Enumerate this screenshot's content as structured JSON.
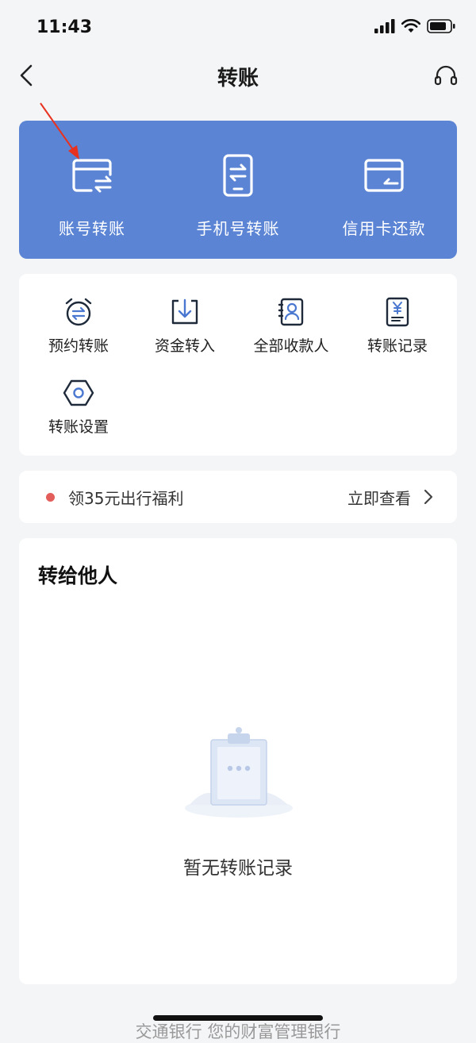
{
  "status_bar": {
    "time": "11:43"
  },
  "nav": {
    "title": "转账"
  },
  "primary_actions": [
    {
      "label": "账号转账",
      "icon": "card-transfer-icon"
    },
    {
      "label": "手机号转账",
      "icon": "phone-transfer-icon"
    },
    {
      "label": "信用卡还款",
      "icon": "credit-card-repay-icon"
    }
  ],
  "tools": [
    {
      "label": "预约转账",
      "icon": "alarm-transfer-icon"
    },
    {
      "label": "资金转入",
      "icon": "fund-in-icon"
    },
    {
      "label": "全部收款人",
      "icon": "contacts-icon"
    },
    {
      "label": "转账记录",
      "icon": "record-icon"
    },
    {
      "label": "转账设置",
      "icon": "settings-hexagon-icon"
    }
  ],
  "promo": {
    "text": "领35元出行福利",
    "link": "立即查看",
    "dot_color": "#e35e5a"
  },
  "transfer_others": {
    "title": "转给他人",
    "empty_text": "暂无转账记录"
  },
  "footer": {
    "text": "交通银行 您的财富管理银行"
  },
  "colors": {
    "primary": "#5b84d4",
    "accent": "#4a78d0",
    "background": "#f4f5f7"
  }
}
